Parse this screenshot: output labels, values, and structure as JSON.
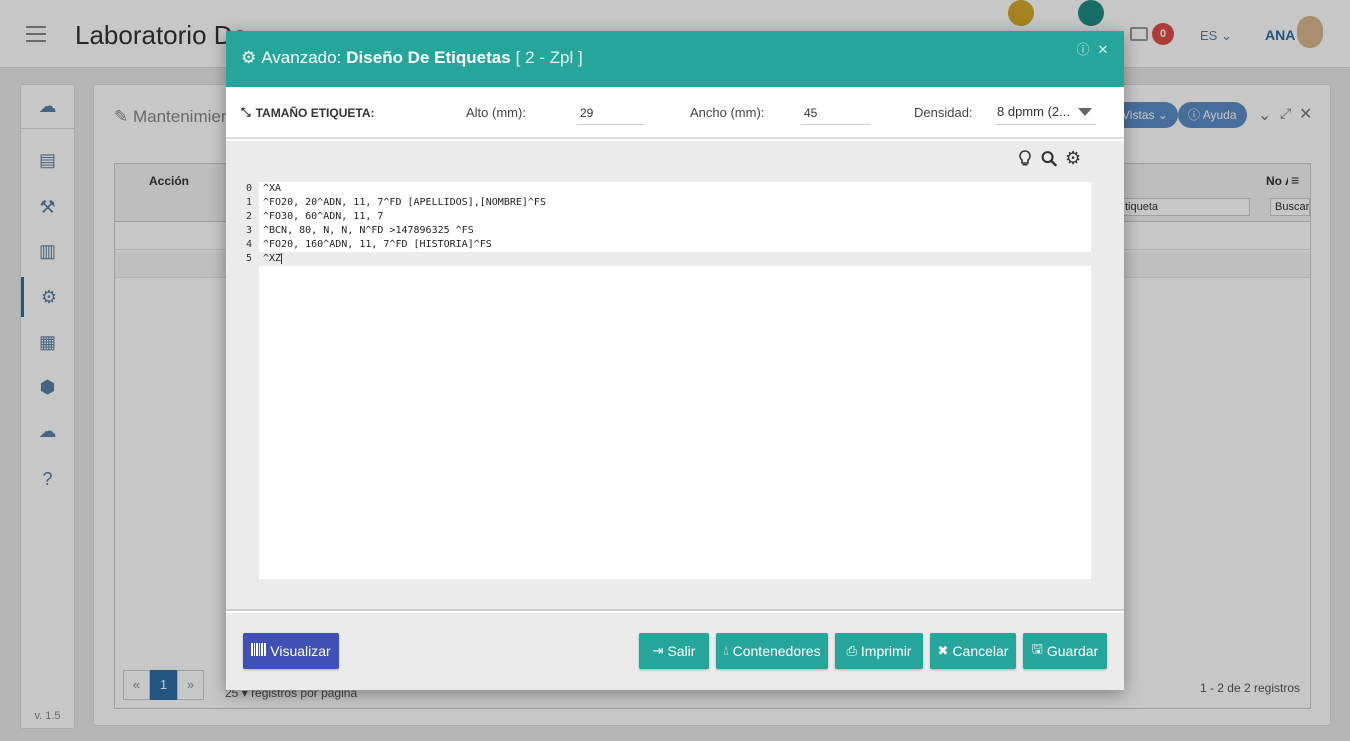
{
  "app": {
    "title": "Laboratorio De",
    "lang": "ES",
    "user": "ANA",
    "notif_count": "0",
    "version": "v. 1.5"
  },
  "panel": {
    "title": "Mantenimien",
    "btn_vistas": "Vistas",
    "btn_ayuda": "Ayuda",
    "col_accion": "Acción",
    "col_no": "No A",
    "filter_etiqueta": "tiqueta",
    "filter_buscar": "Buscar",
    "page_current": "1",
    "per_page_value": "25",
    "per_page_text": "registros por página",
    "records": "1 - 2 de 2 registros"
  },
  "modal": {
    "title_prefix": "Avanzado:",
    "title_main": "Diseño De Etiquetas",
    "title_suffix": "[ 2 - Zpl ]",
    "size_label": "TAMAÑO ETIQUETA:",
    "alto_label": "Alto (mm):",
    "alto_value": "29",
    "ancho_label": "Ancho (mm):",
    "ancho_value": "45",
    "densidad_label": "Densidad:",
    "densidad_value": "8 dpmm (2..."
  },
  "editor": {
    "lines": [
      "^XA",
      "^FO20, 20^ADN, 11, 7^FD [APELLIDOS],[NOMBRE]^FS",
      "^FO30, 60^ADN, 11, 7",
      "^BCN, 80, N, N, N^FD >147896325 ^FS",
      "^FO20, 160^ADN, 11, 7^FD [HISTORIA]^FS",
      "^XZ"
    ],
    "line_numbers": [
      "0",
      "1",
      "2",
      "3",
      "4",
      "5"
    ]
  },
  "footer": {
    "visualizar": "Visualizar",
    "salir": "Salir",
    "contenedores": "Contenedores",
    "imprimir": "Imprimir",
    "cancelar": "Cancelar",
    "guardar": "Guardar"
  },
  "colors": {
    "accent": "#26a69a",
    "indigo": "#3f51b5"
  }
}
